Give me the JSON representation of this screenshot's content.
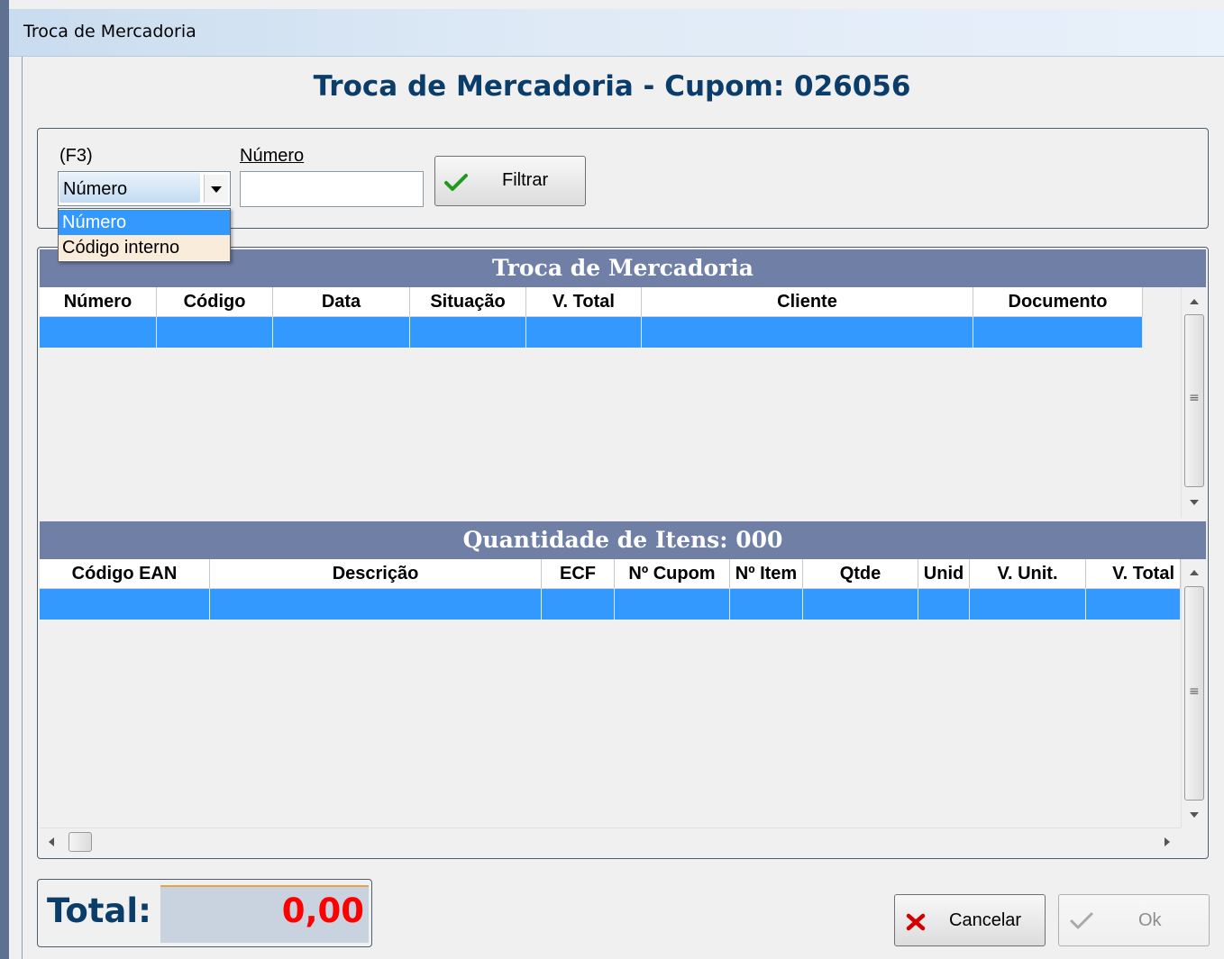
{
  "window": {
    "title": "Troca de Mercadoria"
  },
  "header": {
    "title": "Troca de Mercadoria - Cupom: 026056"
  },
  "filter": {
    "f3_label": "(F3)",
    "numero_label": "Número",
    "combo_value": "Número",
    "combo_options": [
      "Número",
      "Código interno"
    ],
    "numero_value": "",
    "filter_button": "Filtrar"
  },
  "grid1": {
    "title": "Troca de Mercadoria",
    "columns": [
      "Número",
      "Código",
      "Data",
      "Situação",
      "V. Total",
      "Cliente",
      "Documento"
    ],
    "rows": [
      [
        "",
        "",
        "",
        "",
        "",
        "",
        ""
      ]
    ]
  },
  "grid2": {
    "title": "Quantidade de Itens: 000",
    "columns": [
      "Código EAN",
      "Descrição",
      "ECF",
      "Nº Cupom",
      "Nº Item",
      "Qtde",
      "Unid",
      "V. Unit.",
      "V. Total"
    ],
    "rows": [
      [
        "",
        "",
        "",
        "",
        "",
        "",
        "",
        "",
        ""
      ]
    ]
  },
  "total": {
    "label": "Total:",
    "value": "0,00"
  },
  "buttons": {
    "cancel": "Cancelar",
    "ok": "Ok"
  },
  "colors": {
    "band": "#6f7fa6",
    "selection": "#3399ff",
    "title": "#0b3d6b",
    "total_value": "#ff0000",
    "ok_enabled": false
  }
}
